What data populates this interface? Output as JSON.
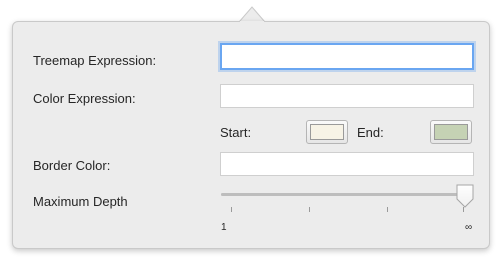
{
  "form": {
    "treemap_label": "Treemap Expression:",
    "treemap_value": "",
    "color_label": "Color Expression:",
    "color_value": "",
    "start_label": "Start:",
    "end_label": "End:",
    "start_color": "#f7f3e6",
    "end_color": "#c5d2b4",
    "border_label": "Border Color:",
    "border_value": "",
    "depth_label": "Maximum Depth",
    "depth_min_label": "1",
    "depth_max_label": "∞",
    "depth_value_fraction": 1.0
  },
  "colors": {
    "focus_ring": "#6aa6f1",
    "panel_bg": "#ececec"
  }
}
